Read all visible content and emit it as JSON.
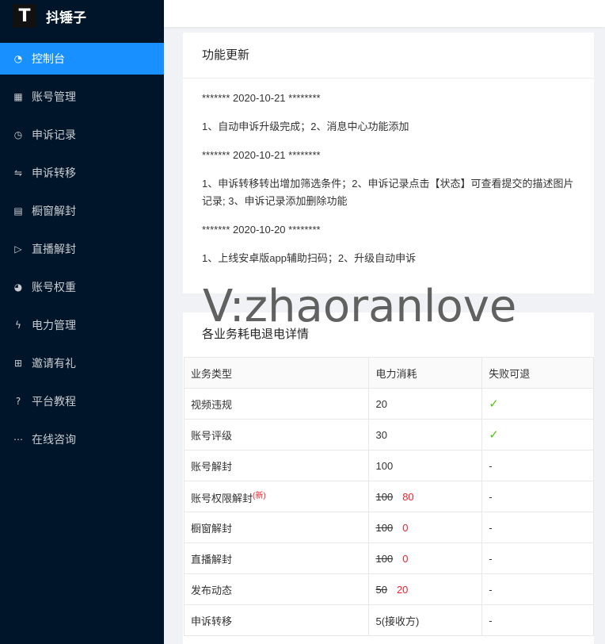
{
  "app": {
    "logo_glyph": "T",
    "name": "抖锤子"
  },
  "sidebar": {
    "items": [
      {
        "label": "控制台",
        "icon": "dashboard-icon",
        "glyph": "◔",
        "active": true
      },
      {
        "label": "账号管理",
        "icon": "table-icon",
        "glyph": "▦",
        "active": false
      },
      {
        "label": "申诉记录",
        "icon": "clock-icon",
        "glyph": "◷",
        "active": false
      },
      {
        "label": "申诉转移",
        "icon": "swap-icon",
        "glyph": "⇋",
        "active": false
      },
      {
        "label": "橱窗解封",
        "icon": "store-icon",
        "glyph": "▤",
        "active": false
      },
      {
        "label": "直播解封",
        "icon": "play-circle-icon",
        "glyph": "▷",
        "active": false
      },
      {
        "label": "账号权重",
        "icon": "pie-chart-icon",
        "glyph": "◕",
        "active": false
      },
      {
        "label": "电力管理",
        "icon": "thunderbolt-icon",
        "glyph": "ϟ",
        "active": false
      },
      {
        "label": "邀请有礼",
        "icon": "gift-icon",
        "glyph": "⊞",
        "active": false
      },
      {
        "label": "平台教程",
        "icon": "question-circle-icon",
        "glyph": "?",
        "active": false
      },
      {
        "label": "在线咨询",
        "icon": "message-icon",
        "glyph": "⋯",
        "active": false
      }
    ]
  },
  "updates": {
    "title": "功能更新",
    "lines": [
      "******* 2020-10-21 ********",
      "1、自动申诉升级完成；2、消息中心功能添加",
      "******* 2020-10-21 ********",
      "1、申诉转移转出增加筛选条件；2、申诉记录点击【状态】可查看提交的描述图片记录; 3、申诉记录添加删除功能",
      "******* 2020-10-20 ********",
      "1、上线安卓版app辅助扫码；2、升级自动申诉"
    ]
  },
  "refund": {
    "title": "各业务耗电退电详情",
    "headers": [
      "业务类型",
      "电力消耗",
      "失败可退"
    ],
    "rows": [
      {
        "type": "视频违规",
        "tag": "",
        "cost": "20",
        "new_cost": "",
        "refund": "✓"
      },
      {
        "type": "账号评级",
        "tag": "",
        "cost": "30",
        "new_cost": "",
        "refund": "✓"
      },
      {
        "type": "账号解封",
        "tag": "",
        "cost": "100",
        "new_cost": "",
        "refund": "-"
      },
      {
        "type": "账号权限解封",
        "tag": "(新)",
        "cost": "100",
        "new_cost": "80",
        "refund": "-"
      },
      {
        "type": "橱窗解封",
        "tag": "",
        "cost": "100",
        "new_cost": "0",
        "refund": "-"
      },
      {
        "type": "直播解封",
        "tag": "",
        "cost": "100",
        "new_cost": "0",
        "refund": "-"
      },
      {
        "type": "发布动态",
        "tag": "",
        "cost": "50",
        "new_cost": "20",
        "refund": "-"
      },
      {
        "type": "申诉转移",
        "tag": "",
        "cost": "5(接收方)",
        "new_cost": "",
        "refund": "-"
      }
    ]
  },
  "watermark": "V:zhaoranlove",
  "colors": {
    "sidebar_bg": "#001529",
    "active": "#1890ff",
    "price_red": "#f5222d",
    "check_green": "#52c41a"
  }
}
